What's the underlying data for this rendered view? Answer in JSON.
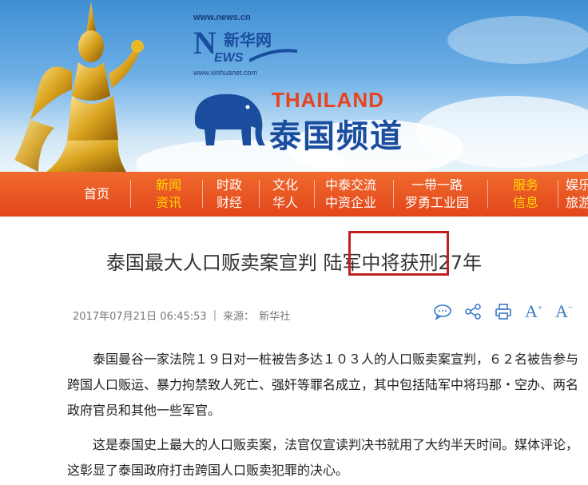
{
  "header": {
    "site_url_top": "www.news.cn",
    "logo_cn": "新华网",
    "logo_en_n": "N",
    "logo_en_rest": "EWS",
    "site_url_bottom": "www.xinhuanet.com",
    "channel_en": "THAILAND",
    "channel_cn": "泰国频道"
  },
  "nav": {
    "items": [
      {
        "line1": "首页",
        "line2": ""
      },
      {
        "line1": "新闻",
        "line2": "资讯"
      },
      {
        "line1": "时政",
        "line2": "财经"
      },
      {
        "line1": "文化",
        "line2": "华人"
      },
      {
        "line1": "中泰交流",
        "line2": "中资企业"
      },
      {
        "line1": "一带一路",
        "line2": "罗勇工业园"
      },
      {
        "line1": "服务",
        "line2": "信息"
      },
      {
        "line1": "娱乐",
        "line2": "旅游"
      }
    ]
  },
  "article": {
    "title": "泰国最大人口贩卖案宣判 陆军中将获刑27年",
    "datetime": "2017年07月21日 06:45:53",
    "source_label": "来源：",
    "source": "新华社",
    "paragraphs": [
      "泰国曼谷一家法院１９日对一桩被告多达１０３人的人口贩卖案宣判，６２名被告参与跨国人口贩运、暴力拘禁致人死亡、强奸等罪名成立，其中包括陆军中将玛那・空办、两名政府官员和其他一些军官。",
      "这是泰国史上最大的人口贩卖案，法官仅宣读判决书就用了大约半天时间。媒体评论，这彰显了泰国政府打击跨国人口贩卖犯罪的决心。"
    ]
  },
  "tools": {
    "comment": "comment-icon",
    "share": "share-icon",
    "print": "print-icon",
    "font_up": "A",
    "font_down": "A"
  },
  "colors": {
    "nav_orange": "#e8501f",
    "nav_highlight": "#ffd700",
    "brand_blue": "#1a4d9e",
    "thailand_orange": "#e8441b",
    "highlight_box": "#c0201e",
    "tool_blue": "#3a78c8"
  }
}
